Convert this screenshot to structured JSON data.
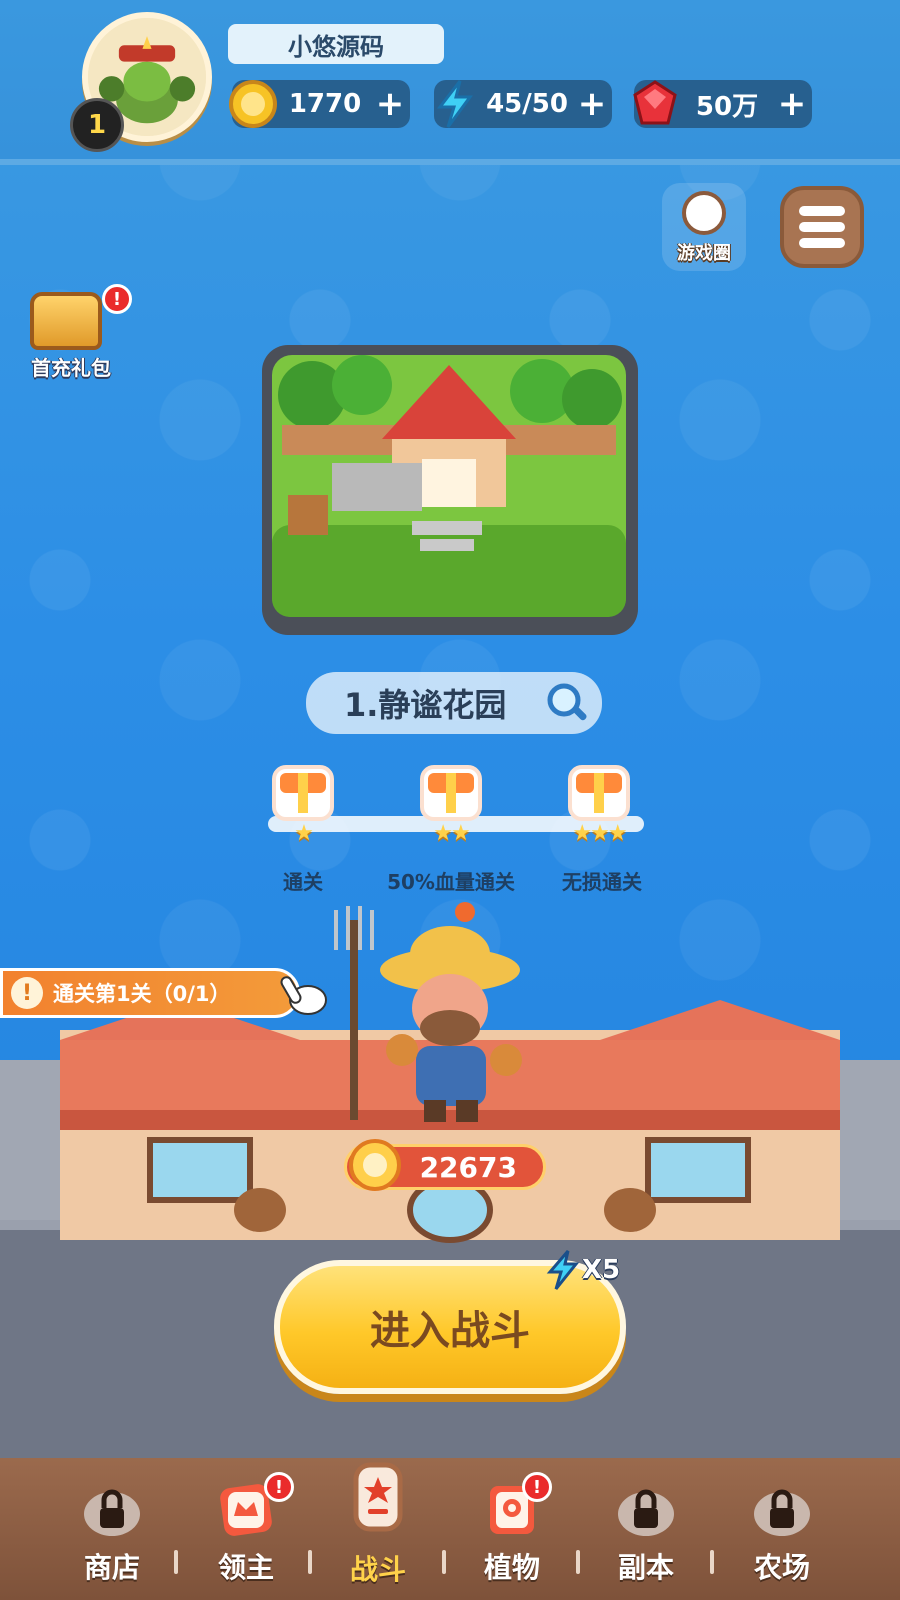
{
  "player": {
    "name": "小悠源码",
    "level": "1"
  },
  "resources": {
    "coins": "1770",
    "energy": "45/50",
    "gems": "50万",
    "plus": "+"
  },
  "top_right": {
    "game_circle_label": "游戏圈"
  },
  "left_panel": {
    "first_gift_label": "首充礼包",
    "alert": "!"
  },
  "stage": {
    "title": "1.静谧花园"
  },
  "rewards": [
    {
      "label": "通关",
      "stars": "★"
    },
    {
      "label": "50%血量通关",
      "stars": "★★"
    },
    {
      "label": "无损通关",
      "stars": "★★★"
    }
  ],
  "quest": {
    "warn": "!",
    "text": "通关第1关（0/1）"
  },
  "combat": {
    "power": "22673",
    "enter_label": "进入战斗",
    "energy_cost": "X5"
  },
  "nav": {
    "items": [
      {
        "label": "商店",
        "locked": true,
        "alert": false
      },
      {
        "label": "领主",
        "locked": false,
        "alert": true
      },
      {
        "label": "战斗",
        "locked": false,
        "alert": false,
        "active": true
      },
      {
        "label": "植物",
        "locked": false,
        "alert": true
      },
      {
        "label": "副本",
        "locked": true,
        "alert": false
      },
      {
        "label": "农场",
        "locked": true,
        "alert": false
      }
    ]
  },
  "colors": {
    "background": "#2c8ee6",
    "accent_yellow": "#ffc829",
    "brown_nav": "#9b6a4d",
    "alert_red": "#ea2b2b"
  }
}
